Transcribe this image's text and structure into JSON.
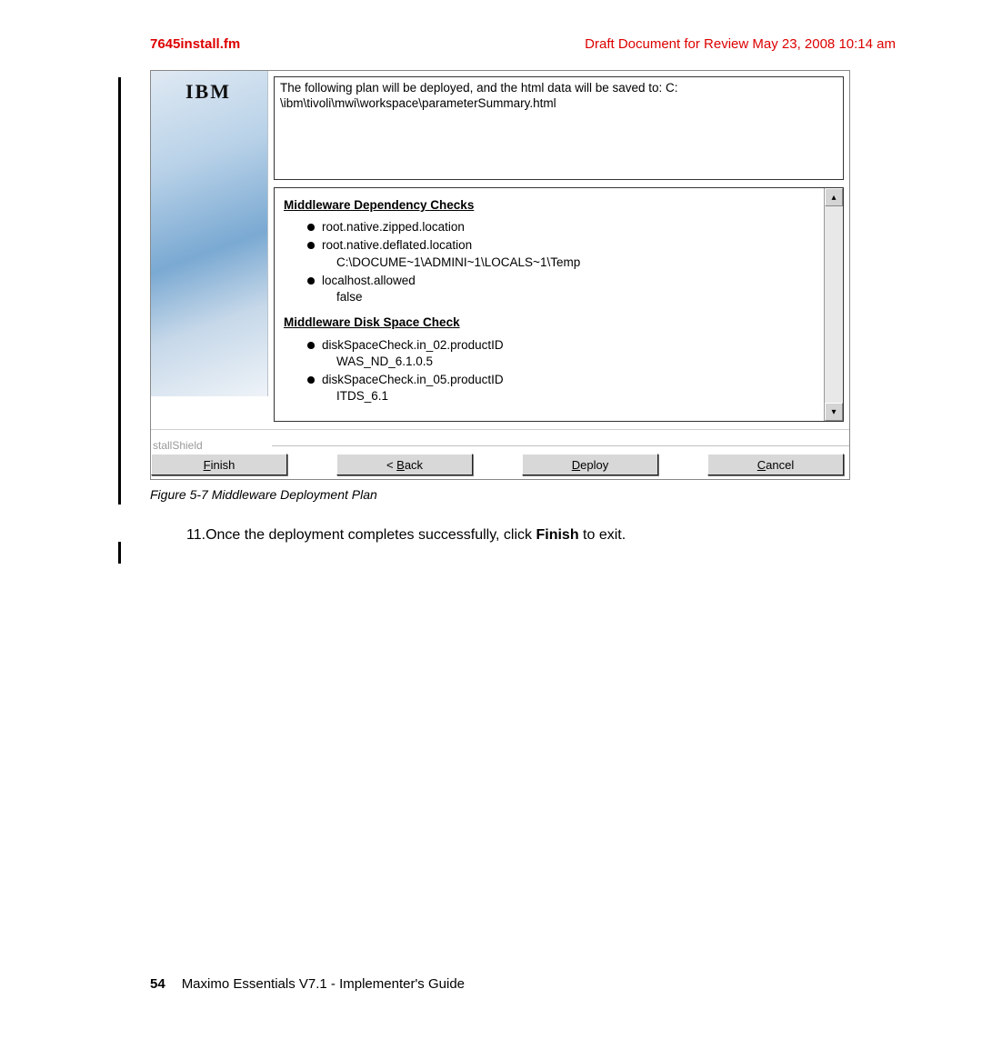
{
  "header": {
    "left": "7645install.fm",
    "right": "Draft Document for Review May 23, 2008 10:14 am"
  },
  "ibm_logo": "IBM",
  "plan_text_line1": "The following plan will be deployed, and the html data will be saved to: C:",
  "plan_text_line2": "\\ibm\\tivoli\\mwi\\workspace\\parameterSummary.html",
  "section1_title": "Middleware Dependency Checks",
  "section1_items": [
    {
      "main": "root.native.zipped.location"
    },
    {
      "main": "root.native.deflated.location",
      "sub": "C:\\DOCUME~1\\ADMINI~1\\LOCALS~1\\Temp"
    },
    {
      "main": "localhost.allowed",
      "sub": "false"
    }
  ],
  "section2_title": "Middleware Disk Space Check",
  "section2_items": [
    {
      "main": "diskSpaceCheck.in_02.productID",
      "sub": "WAS_ND_6.1.0.5"
    },
    {
      "main": "diskSpaceCheck.in_05.productID",
      "sub": "ITDS_6.1"
    }
  ],
  "shield_label": "stallShield",
  "buttons": {
    "finish_u": "F",
    "finish_rest": "inish",
    "back_pre": "< ",
    "back_u": "B",
    "back_rest": "ack",
    "deploy_u": "D",
    "deploy_rest": "eploy",
    "cancel_u": "C",
    "cancel_rest": "ancel"
  },
  "caption": "Figure 5-7   Middleware Deployment Plan",
  "step_num": "11.",
  "step_text_a": "Once the deployment completes successfully, click ",
  "step_bold": "Finish",
  "step_text_b": " to exit.",
  "footer": {
    "page": "54",
    "title": "Maximo Essentials V7.1 - Implementer's Guide"
  }
}
